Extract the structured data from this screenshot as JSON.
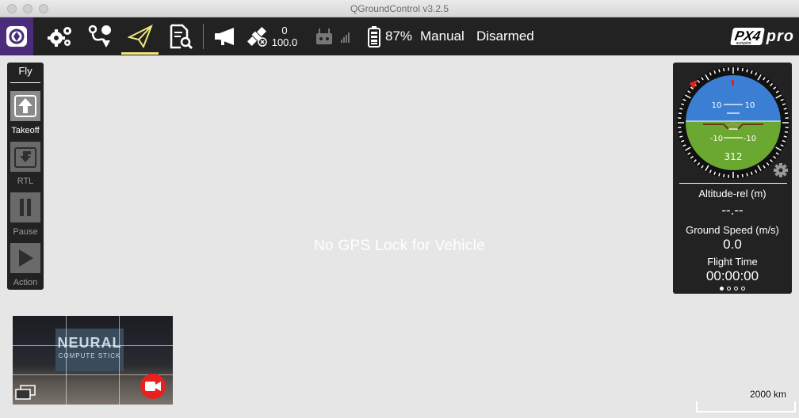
{
  "window": {
    "title": "QGroundControl v3.2.5"
  },
  "toolbar": {
    "gps_count": "0",
    "gps_hdop": "100.0",
    "battery": "87%",
    "flight_mode": "Manual",
    "arm_status": "Disarmed",
    "brand_box": "PX4",
    "brand_sub": "autopilot",
    "brand_pro": "pro"
  },
  "fly_tools": {
    "title": "Fly",
    "items": [
      {
        "label": "Takeoff",
        "icon": "takeoff-icon",
        "enabled": true
      },
      {
        "label": "RTL",
        "icon": "rtl-icon",
        "enabled": false
      },
      {
        "label": "Pause",
        "icon": "pause-icon",
        "enabled": false
      },
      {
        "label": "Action",
        "icon": "action-icon",
        "enabled": false
      }
    ]
  },
  "map": {
    "message": "No GPS Lock for Vehicle",
    "scale_label": "2000 km"
  },
  "instrument": {
    "pitch_labels": [
      "10",
      "10",
      "-10",
      "-10"
    ],
    "heading": "312",
    "values": [
      {
        "label": "Altitude-rel (m)",
        "value": "--.--"
      },
      {
        "label": "Ground Speed (m/s)",
        "value": "0.0"
      },
      {
        "label": "Flight Time",
        "value": "00:00:00"
      }
    ],
    "page_dots": 4,
    "active_page": 0
  },
  "video": {
    "overlay_big": "NEURAL",
    "overlay_small": "COMPUTE STICK"
  },
  "colors": {
    "toolbar_bg": "#222222",
    "qgc_button": "#4a2c7a",
    "active_underline": "#f2e77d",
    "sky": "#3a7fd4",
    "ground": "#6aa832",
    "record": "#e8201e"
  }
}
